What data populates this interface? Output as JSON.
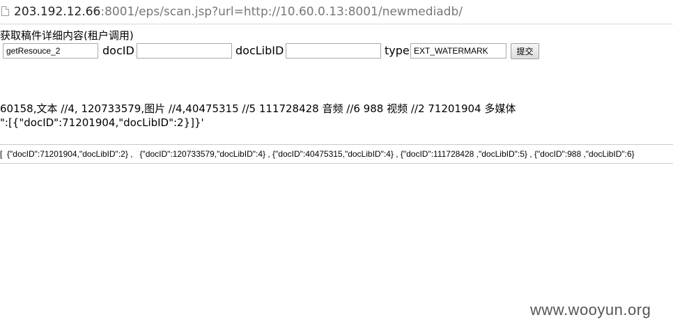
{
  "address_bar": {
    "host": "203.192.12.66",
    "rest": ":8001/eps/scan.jsp?url=http://10.60.0.13:8001/newmediadb/"
  },
  "form": {
    "title": "获取稿件详细内容(租户调用)",
    "method_value": "getResouce_2",
    "docid_label": "docID",
    "docid_value": "",
    "doclibid_label": "docLibID",
    "doclibid_value": "",
    "type_label": "type",
    "type_value": "EXT_WATERMARK",
    "submit_label": "提交"
  },
  "info": {
    "line1": "60158,文本 //4, 120733579,图片 //4,40475315 //5 111728428 音频 //6 988 视频 //2 71201904 多媒体",
    "line2": "\":[{\"docID\":71201904,\"docLibID\":2}]}'"
  },
  "result": {
    "text": "[  {\"docID\":71201904,\"docLibID\":2} ,   {\"docID\":120733579,\"docLibID\":4} , {\"docID\":40475315,\"docLibID\":4} , {\"docID\":111728428 ,\"docLibID\":5} , {\"docID\":988 ,\"docLibID\":6}"
  },
  "watermark": "www.wooyun.org"
}
